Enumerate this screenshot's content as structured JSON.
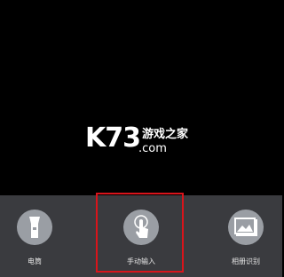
{
  "watermark": {
    "logo": "K73",
    "site_name_cn": "游戏之家",
    "domain": ".com"
  },
  "toolbar": {
    "items": [
      {
        "label": "电筒",
        "icon": "flashlight-icon"
      },
      {
        "label": "手动输入",
        "icon": "tap-hand-icon"
      },
      {
        "label": "相册识别",
        "icon": "album-image-icon"
      }
    ]
  },
  "highlight": {
    "target": "手动输入",
    "color": "#d9141b"
  }
}
